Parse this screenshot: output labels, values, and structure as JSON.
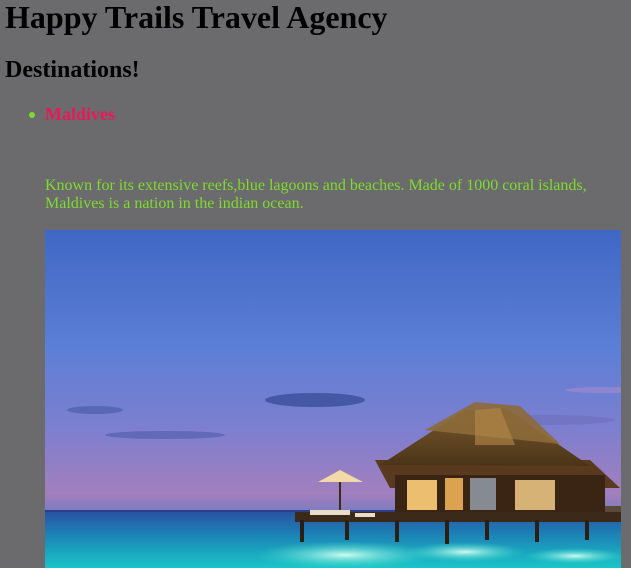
{
  "site": {
    "title": "Happy Trails Travel Agency"
  },
  "destinations_heading": "Destinations!",
  "destinations": [
    {
      "name": "Maldives",
      "description": "Known for its extensive reefs,blue lagoons and beaches. Made of 1000 coral islands, Maldives is a nation in the indian ocean."
    }
  ],
  "colors": {
    "page_background": "#6b6a6c",
    "heading_text": "#000000",
    "destination_name": "#e8195a",
    "description_text": "#7ddc2e",
    "bullet": "#7ddc2e"
  }
}
